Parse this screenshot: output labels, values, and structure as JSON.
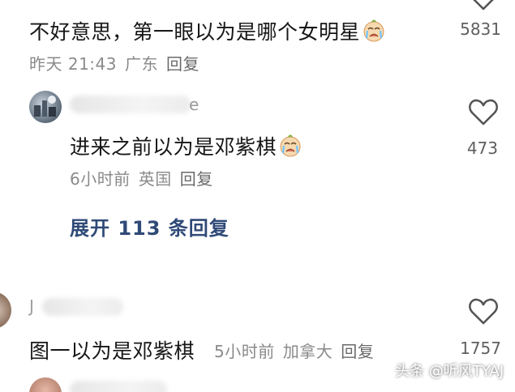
{
  "comments": [
    {
      "text": "不好意思，第一眼以为是哪个女明星",
      "emoji": "crying-face-emoji",
      "time": "昨天 21:43",
      "location": "广东",
      "reply": "回复",
      "likes": "5831"
    },
    {
      "username_tail": "e",
      "text": "进来之前以为是邓紫棋",
      "emoji": "crying-face-emoji",
      "time": "6小时前",
      "location": "英国",
      "reply": "回复",
      "likes": "473"
    },
    {
      "username_initial": "J",
      "text": "图一以为是邓紫棋",
      "time": "5小时前",
      "location": "加拿大",
      "reply": "回复",
      "likes": "1757"
    }
  ],
  "expand_replies": "展开 113 条回复",
  "watermark": "头条 @听风TYAJ",
  "colors": {
    "accent_link": "#2f4a77",
    "meta_gray": "#8a8a8a",
    "icon_gray": "#555555"
  }
}
